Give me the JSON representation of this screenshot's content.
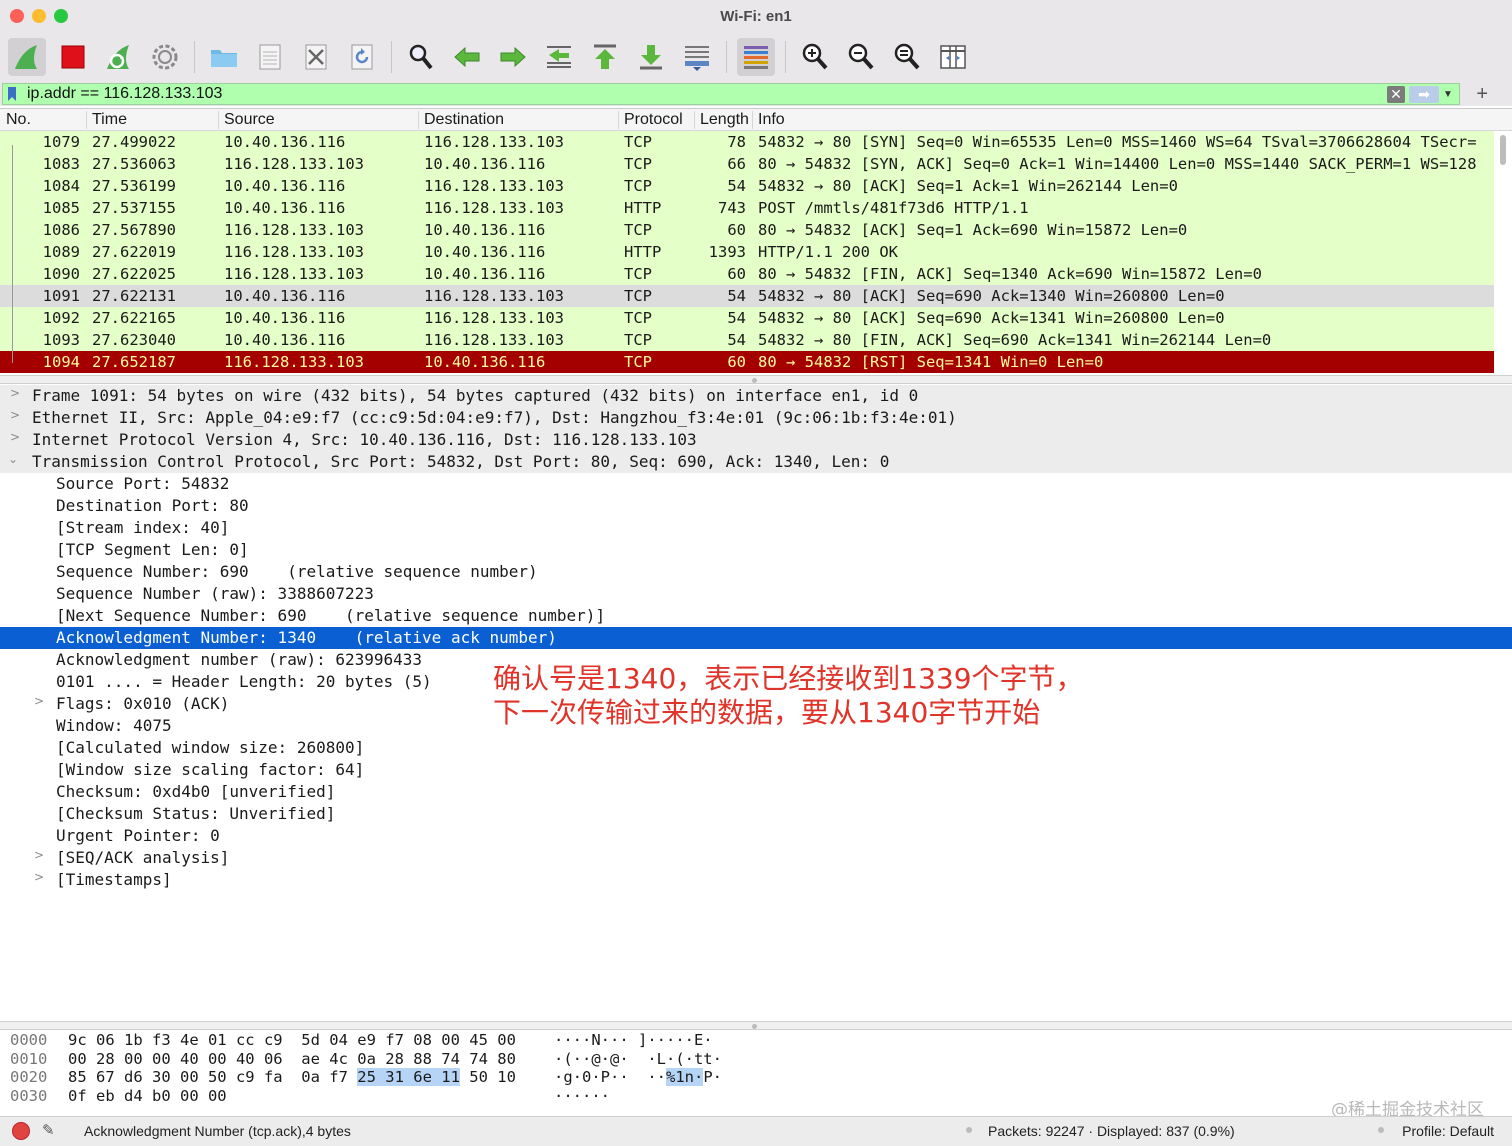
{
  "window": {
    "title": "Wi-Fi: en1"
  },
  "toolbar": {
    "icons": [
      "shark-fin-start-icon",
      "stop-icon",
      "restart-icon",
      "capture-options-gear-icon",
      "open-folder-icon",
      "save-file-icon",
      "close-file-icon",
      "reload-icon",
      "find-packet-icon",
      "go-back-icon",
      "go-forward-icon",
      "go-to-packet-icon",
      "first-packet-icon",
      "last-packet-icon",
      "autoscroll-icon",
      "colorize-icon",
      "zoom-in-icon",
      "zoom-out-icon",
      "zoom-normal-icon",
      "resize-columns-icon"
    ],
    "colors": {
      "start": "#3fa84a",
      "stop": "#e0101a",
      "accent_green": "#2aa33a"
    }
  },
  "filter": {
    "value": "ip.addr == 116.128.133.103",
    "add_label": "+"
  },
  "packet_list": {
    "columns": {
      "no": "No.",
      "time": "Time",
      "source": "Source",
      "destination": "Destination",
      "protocol": "Protocol",
      "length": "Length",
      "info": "Info"
    },
    "rows": [
      {
        "no": "1079",
        "time": "27.499022",
        "src": "10.40.136.116",
        "dst": "116.128.133.103",
        "proto": "TCP",
        "len": "78",
        "info": "54832 → 80 [SYN] Seq=0 Win=65535 Len=0 MSS=1460 WS=64 TSval=3706628604 TSecr="
      },
      {
        "no": "1083",
        "time": "27.536063",
        "src": "116.128.133.103",
        "dst": "10.40.136.116",
        "proto": "TCP",
        "len": "66",
        "info": "80 → 54832 [SYN, ACK] Seq=0 Ack=1 Win=14400 Len=0 MSS=1440 SACK_PERM=1 WS=128"
      },
      {
        "no": "1084",
        "time": "27.536199",
        "src": "10.40.136.116",
        "dst": "116.128.133.103",
        "proto": "TCP",
        "len": "54",
        "info": "54832 → 80 [ACK] Seq=1 Ack=1 Win=262144 Len=0"
      },
      {
        "no": "1085",
        "time": "27.537155",
        "src": "10.40.136.116",
        "dst": "116.128.133.103",
        "proto": "HTTP",
        "len": "743",
        "info": "POST /mmtls/481f73d6 HTTP/1.1"
      },
      {
        "no": "1086",
        "time": "27.567890",
        "src": "116.128.133.103",
        "dst": "10.40.136.116",
        "proto": "TCP",
        "len": "60",
        "info": "80 → 54832 [ACK] Seq=1 Ack=690 Win=15872 Len=0"
      },
      {
        "no": "1089",
        "time": "27.622019",
        "src": "116.128.133.103",
        "dst": "10.40.136.116",
        "proto": "HTTP",
        "len": "1393",
        "info": "HTTP/1.1 200 OK"
      },
      {
        "no": "1090",
        "time": "27.622025",
        "src": "116.128.133.103",
        "dst": "10.40.136.116",
        "proto": "TCP",
        "len": "60",
        "info": "80 → 54832 [FIN, ACK] Seq=1340 Ack=690 Win=15872 Len=0"
      },
      {
        "no": "1091",
        "time": "27.622131",
        "src": "10.40.136.116",
        "dst": "116.128.133.103",
        "proto": "TCP",
        "len": "54",
        "info": "54832 → 80 [ACK] Seq=690 Ack=1340 Win=260800 Len=0"
      },
      {
        "no": "1092",
        "time": "27.622165",
        "src": "10.40.136.116",
        "dst": "116.128.133.103",
        "proto": "TCP",
        "len": "54",
        "info": "54832 → 80 [ACK] Seq=690 Ack=1341 Win=260800 Len=0"
      },
      {
        "no": "1093",
        "time": "27.623040",
        "src": "10.40.136.116",
        "dst": "116.128.133.103",
        "proto": "TCP",
        "len": "54",
        "info": "54832 → 80 [FIN, ACK] Seq=690 Ack=1341 Win=262144 Len=0"
      },
      {
        "no": "1094",
        "time": "27.652187",
        "src": "116.128.133.103",
        "dst": "10.40.136.116",
        "proto": "TCP",
        "len": "60",
        "info": "80 → 54832 [RST] Seq=1341 Win=0 Len=0"
      }
    ],
    "colors": {
      "row_bg": "#e4ffc7",
      "selected_bg": "#dcdcdc",
      "rst_bg": "#a40000",
      "rst_fg": "#fffc9c"
    }
  },
  "details": {
    "lines": [
      {
        "text": "Frame 1091: 54 bytes on wire (432 bits), 54 bytes captured (432 bits) on interface en1, id 0",
        "arrow": ">"
      },
      {
        "text": "Ethernet II, Src: Apple_04:e9:f7 (cc:c9:5d:04:e9:f7), Dst: Hangzhou_f3:4e:01 (9c:06:1b:f3:4e:01)",
        "arrow": ">"
      },
      {
        "text": "Internet Protocol Version 4, Src: 10.40.136.116, Dst: 116.128.133.103",
        "arrow": ">"
      },
      {
        "text": "Transmission Control Protocol, Src Port: 54832, Dst Port: 80, Seq: 690, Ack: 1340, Len: 0",
        "arrow": "v"
      },
      {
        "text": "Source Port: 54832",
        "arrow": ""
      },
      {
        "text": "Destination Port: 80",
        "arrow": ""
      },
      {
        "text": "[Stream index: 40]",
        "arrow": ""
      },
      {
        "text": "[TCP Segment Len: 0]",
        "arrow": ""
      },
      {
        "text": "Sequence Number: 690    (relative sequence number)",
        "arrow": ""
      },
      {
        "text": "Sequence Number (raw): 3388607223",
        "arrow": ""
      },
      {
        "text": "[Next Sequence Number: 690    (relative sequence number)]",
        "arrow": ""
      },
      {
        "text": "Acknowledgment Number: 1340    (relative ack number)",
        "arrow": ""
      },
      {
        "text": "Acknowledgment number (raw): 623996433",
        "arrow": ""
      },
      {
        "text": "0101 .... = Header Length: 20 bytes (5)",
        "arrow": ""
      },
      {
        "text": "Flags: 0x010 (ACK)",
        "arrow": ">"
      },
      {
        "text": "Window: 4075",
        "arrow": ""
      },
      {
        "text": "[Calculated window size: 260800]",
        "arrow": ""
      },
      {
        "text": "[Window size scaling factor: 64]",
        "arrow": ""
      },
      {
        "text": "Checksum: 0xd4b0 [unverified]",
        "arrow": ""
      },
      {
        "text": "[Checksum Status: Unverified]",
        "arrow": ""
      },
      {
        "text": "Urgent Pointer: 0",
        "arrow": ""
      },
      {
        "text": "[SEQ/ACK analysis]",
        "arrow": ">"
      },
      {
        "text": "[Timestamps]",
        "arrow": ">"
      }
    ],
    "highlight_color": "#0a5fd3"
  },
  "annotation": {
    "line1": "确认号是1340，表示已经接收到1339个字节，",
    "line2": "下一次传输过来的数据，要从1340字节开始",
    "color": "#e0342a"
  },
  "bytes": {
    "rows": [
      {
        "offset": "0000",
        "hex_pre": "9c 06 1b f3 4e 01 cc c9  5d 04 e9 f7 08 00 45 00",
        "hex_hl": "",
        "hex_post": "",
        "ascii_pre": "····N··· ]·····E·",
        "ascii_hl": "",
        "ascii_post": ""
      },
      {
        "offset": "0010",
        "hex_pre": "00 28 00 00 40 00 40 06  ae 4c 0a 28 88 74 74 80",
        "hex_hl": "",
        "hex_post": "",
        "ascii_pre": "·(··@·@·  ·L·(·tt·",
        "ascii_hl": "",
        "ascii_post": ""
      },
      {
        "offset": "0020",
        "hex_pre": "85 67 d6 30 00 50 c9 fa  0a f7 ",
        "hex_hl": "25 31 6e 11",
        "hex_post": " 50 10",
        "ascii_pre": "·g·0·P··  ··",
        "ascii_hl": "%1n·",
        "ascii_post": "P·"
      },
      {
        "offset": "0030",
        "hex_pre": "0f eb d4 b0 00 00",
        "hex_hl": "",
        "hex_post": "",
        "ascii_pre": "······",
        "ascii_hl": "",
        "ascii_post": ""
      }
    ]
  },
  "status": {
    "field": "Acknowledgment Number (tcp.ack),4 bytes",
    "packets": "Packets: 92247 · Displayed: 837 (0.9%)",
    "profile": "Profile: Default"
  },
  "watermark": "@稀土掘金技术社区"
}
